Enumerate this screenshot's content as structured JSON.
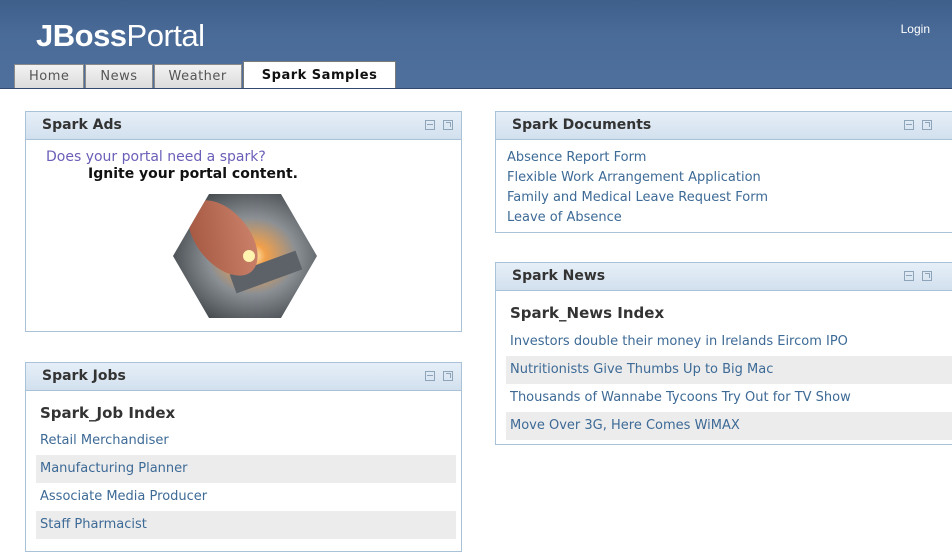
{
  "header": {
    "logo_bold": "JBoss",
    "logo_light": "Portal",
    "login": "Login"
  },
  "tabs": [
    {
      "label": "Home",
      "active": false
    },
    {
      "label": "News",
      "active": false
    },
    {
      "label": "Weather",
      "active": false
    },
    {
      "label": "Spark Samples",
      "active": true
    }
  ],
  "ads": {
    "title": "Spark Ads",
    "question": "Does your portal need a spark?",
    "tagline": "Ignite your portal content."
  },
  "jobs": {
    "title": "Spark Jobs",
    "index_title": "Spark_Job Index",
    "items": [
      "Retail Merchandiser",
      "Manufacturing Planner",
      "Associate Media Producer",
      "Staff Pharmacist"
    ]
  },
  "documents": {
    "title": "Spark Documents",
    "items": [
      "Absence Report Form",
      "Flexible Work Arrangement Application",
      "Family and Medical Leave Request Form",
      "Leave of Absence"
    ]
  },
  "news": {
    "title": "Spark News",
    "index_title": "Spark_News Index",
    "items": [
      "Investors double their money in Irelands Eircom IPO",
      "Nutritionists Give Thumbs Up to Big Mac",
      "Thousands of Wannabe Tycoons Try Out for TV Show",
      "Move Over 3G, Here Comes WiMAX"
    ]
  },
  "colors": {
    "header_blue": "#4a6b98",
    "link": "#3d6a96",
    "portlet_border": "#aac2d8",
    "ad_question": "#6a5fb8"
  },
  "icons": [
    "minimize-icon",
    "maximize-icon"
  ]
}
